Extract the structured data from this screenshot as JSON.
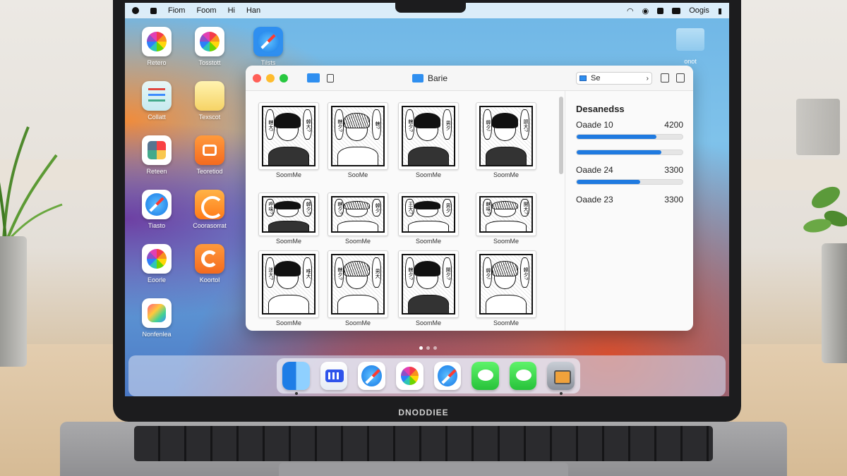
{
  "menubar": {
    "items": [
      "Fiom",
      "Foom",
      "Hi",
      "Han"
    ],
    "right_label": "Oogis"
  },
  "desktop_icons": [
    {
      "label": "Retero",
      "icon": "photos-icon"
    },
    {
      "label": "Tosstott",
      "icon": "photos-icon"
    },
    {
      "label": "Tilsts",
      "icon": "safari-icon"
    },
    {
      "label": "Collatt",
      "icon": "reminders-icon"
    },
    {
      "label": "Texscot",
      "icon": "notes-icon"
    },
    {
      "label": "Reteen",
      "icon": "mosaic-icon"
    },
    {
      "label": "Teoretiod",
      "icon": "bag-icon"
    },
    {
      "label": "Tiasto",
      "icon": "safari-icon"
    },
    {
      "label": "Coorasorrat",
      "icon": "spiral-icon"
    },
    {
      "label": "Eoorle",
      "icon": "photos-icon"
    },
    {
      "label": "Koortol",
      "icon": "c-icon"
    },
    {
      "label": "Nonfenlea",
      "icon": "colorful-icon"
    },
    {
      "label": "onot",
      "icon": "folder-icon"
    }
  ],
  "window": {
    "title": "Barie",
    "search_value": "Se",
    "thumbnails": [
      {
        "caption": "SoomMe",
        "bubble_a": "轄大!",
        "bubble_b": "韓大?"
      },
      {
        "caption": "SooMe",
        "bubble_a": "轄夕?",
        "bubble_b": "轄?"
      },
      {
        "caption": "SoomMe",
        "bubble_a": "轄夕?",
        "bubble_b": "男夕"
      },
      {
        "caption": "SoomMe",
        "bubble_a": "韓夕!",
        "bubble_b": "胆大?"
      },
      {
        "caption": "SoomMe",
        "bubble_a": "呼味?",
        "bubble_b": "韓夕?"
      },
      {
        "caption": "SoomMe",
        "bubble_a": "轄夕?",
        "bubble_b": "韓夕"
      },
      {
        "caption": "SoomMe",
        "bubble_a": "王大?",
        "bubble_b": "男夕"
      },
      {
        "caption": "SoomMe",
        "bubble_a": "轄味?",
        "bubble_b": "開大?"
      },
      {
        "caption": "SoomMe",
        "bubble_a": "迷大?",
        "bubble_b": "唯大"
      },
      {
        "caption": "SoomMe",
        "bubble_a": "轄夕?",
        "bubble_b": "男大"
      },
      {
        "caption": "SoomMe",
        "bubble_a": "轄夕?",
        "bubble_b": "開夕?"
      },
      {
        "caption": "SoomMe",
        "bubble_a": "韓夕!",
        "bubble_b": "韓夕?"
      }
    ],
    "sidebar": {
      "heading": "Desanedss",
      "rows": [
        {
          "label": "Oaade 10",
          "value": "4200",
          "progress": 0.75
        },
        {
          "label": "",
          "value": "",
          "progress": 0.8
        },
        {
          "label": "Oaade 24",
          "value": "3300",
          "progress": 0.6
        },
        {
          "label": "Oaade 23",
          "value": "3300",
          "progress": null
        }
      ]
    }
  },
  "dock": [
    "finder-icon",
    "launchpad-icon",
    "safari-icon",
    "photos-icon",
    "safari-icon",
    "messages-icon",
    "messages-icon",
    "camera-icon"
  ],
  "laptop_brand": "DNODDIEE",
  "colors": {
    "accent": "#1f7ae0",
    "traffic_red": "#ff5f57",
    "traffic_yellow": "#febc2e",
    "traffic_green": "#28c840"
  }
}
